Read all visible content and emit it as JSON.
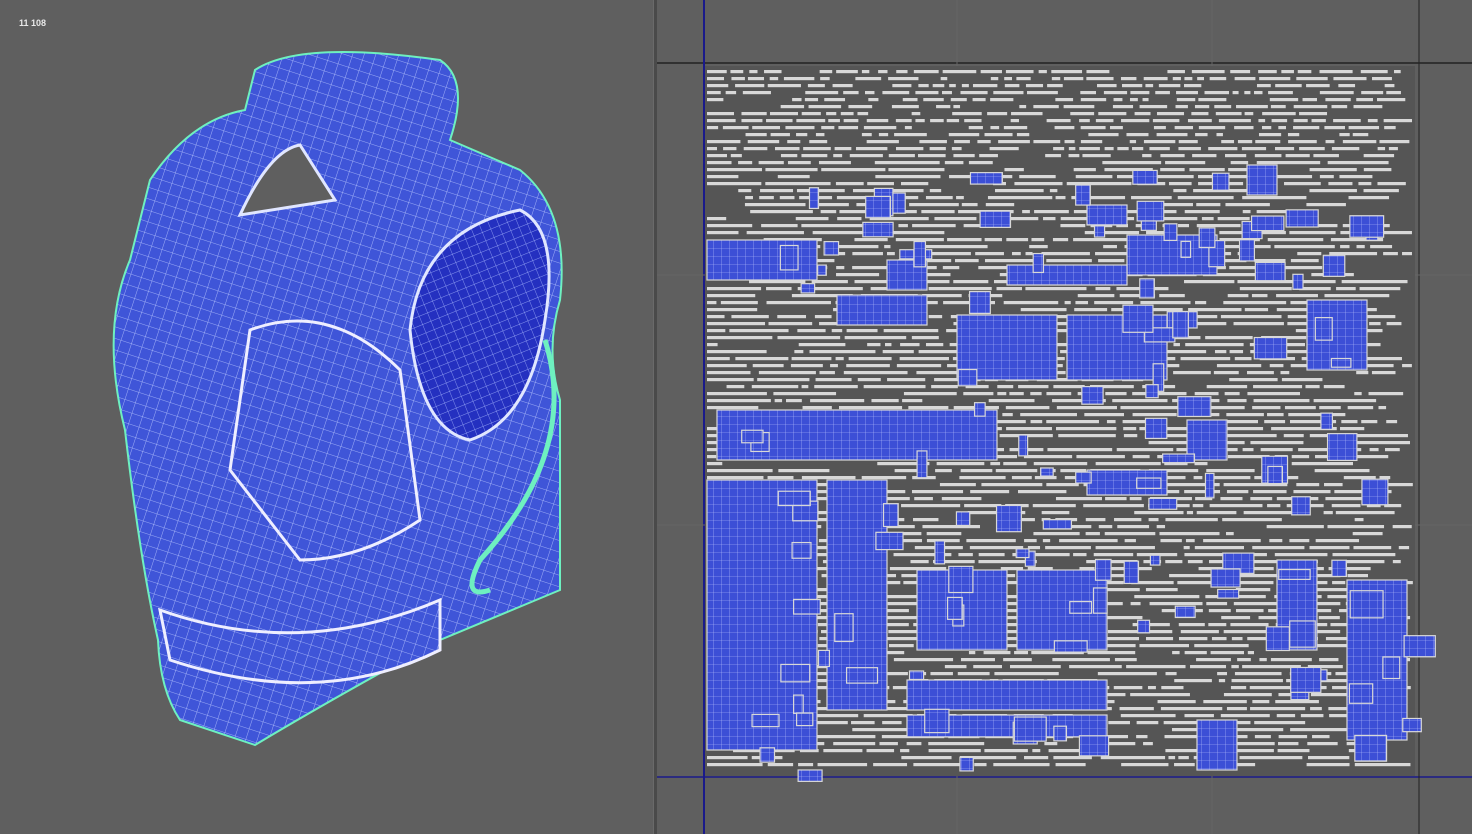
{
  "viewport": {
    "poly_count": "11 108"
  },
  "colors": {
    "background": "#5f5f5f",
    "uv_shell": "#3c4fd6",
    "wire": "#c9d4ff",
    "wire_green": "#6ef0c0",
    "uv_space": "#555555",
    "axis_u": "#1a1a8a",
    "uv_edge": "#d8d8d8"
  }
}
